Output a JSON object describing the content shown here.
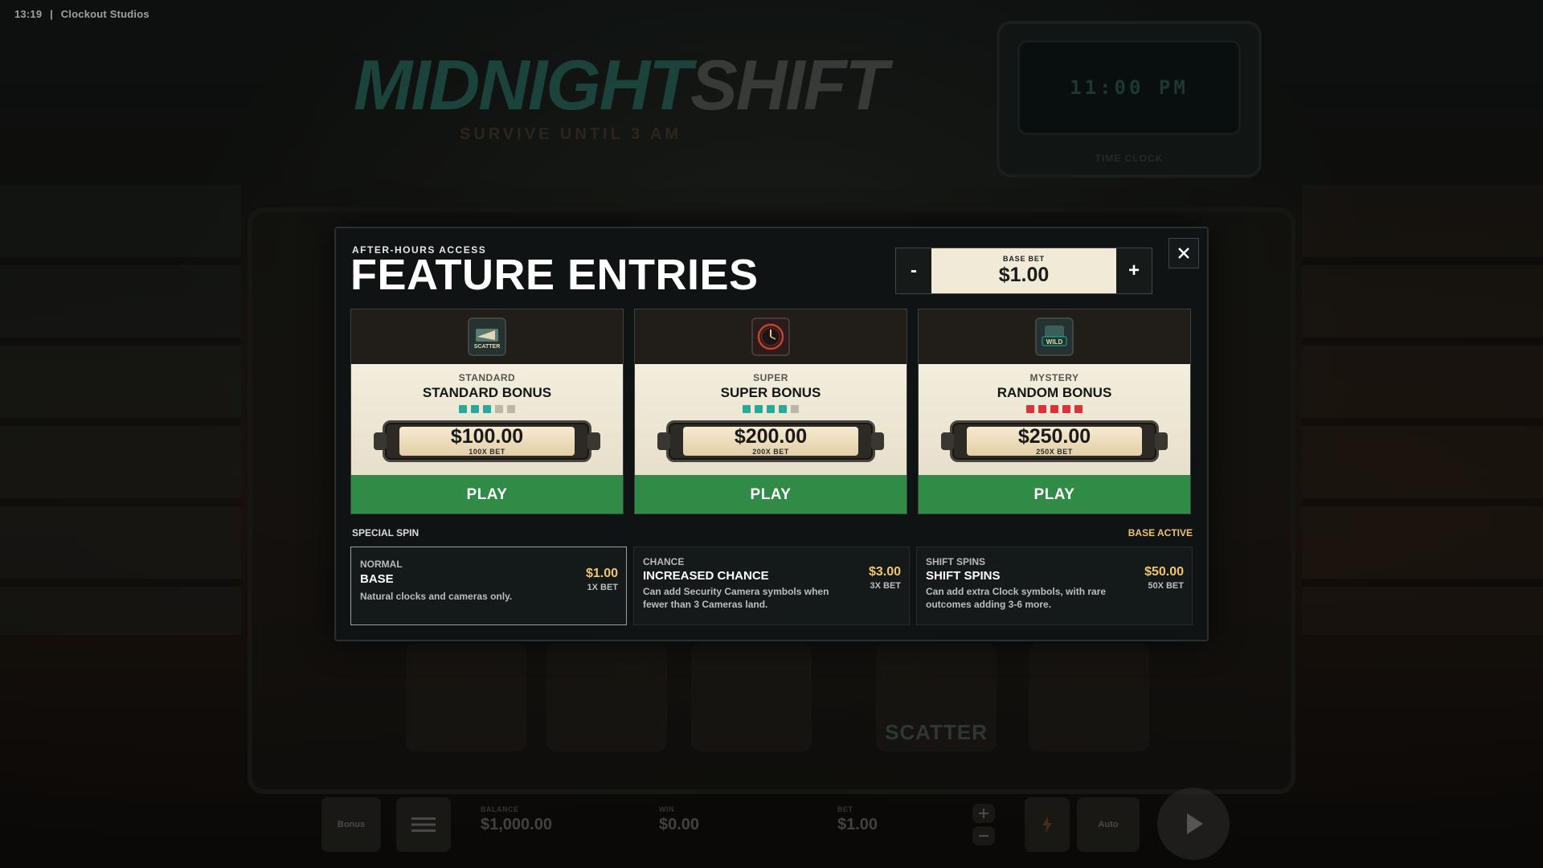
{
  "status_bar": {
    "time": "13:19",
    "separator": "|",
    "studio": "Clockout Studios"
  },
  "logo": {
    "word1": "MIDNIGHT",
    "word2": "SHIFT",
    "tagline": "SURVIVE UNTIL 3 AM"
  },
  "time_clock": {
    "display": "11:00 PM",
    "label": "TIME CLOCK"
  },
  "reel_symbol_label": "SCATTER",
  "bottom_bar": {
    "bonus_label": "Bonus",
    "balance_label": "BALANCE",
    "balance_value": "$1,000.00",
    "win_label": "WIN",
    "win_value": "$0.00",
    "bet_label": "BET",
    "bet_value": "$1.00",
    "auto_label": "Auto"
  },
  "modal": {
    "eyebrow": "AFTER-HOURS ACCESS",
    "title": "FEATURE ENTRIES",
    "base_bet": {
      "label": "BASE BET",
      "value": "$1.00",
      "decrement": "-",
      "increment": "+"
    },
    "close_icon": "close-icon",
    "cards": [
      {
        "tier": "STANDARD",
        "name": "STANDARD BONUS",
        "icon": "scatter-icon",
        "icon_text": "SCATTER",
        "price": "$100.00",
        "multiplier": "100X BET",
        "pips_filled": 3,
        "pips_total": 5,
        "pip_color": "#2aa89a",
        "play_label": "PLAY"
      },
      {
        "tier": "SUPER",
        "name": "SUPER BONUS",
        "icon": "clock-icon",
        "icon_text": "",
        "price": "$200.00",
        "multiplier": "200X BET",
        "pips_filled": 4,
        "pips_total": 5,
        "pip_color": "#2aa89a",
        "play_label": "PLAY"
      },
      {
        "tier": "MYSTERY",
        "name": "RANDOM BONUS",
        "icon": "wild-icon",
        "icon_text": "WILD",
        "price": "$250.00",
        "multiplier": "250X BET",
        "pips_filled": 5,
        "pips_total": 5,
        "pip_color": "#d8343a",
        "play_label": "PLAY"
      }
    ],
    "special_spin_label": "SPECIAL SPIN",
    "special_spin_status": "BASE ACTIVE",
    "spin_options": [
      {
        "tag": "NORMAL",
        "name": "BASE",
        "desc": "Natural clocks and cameras only.",
        "price": "$1.00",
        "multiplier": "1X BET",
        "active": true
      },
      {
        "tag": "CHANCE",
        "name": "INCREASED CHANCE",
        "desc": "Can add Security Camera symbols when fewer than 3 Cameras land.",
        "price": "$3.00",
        "multiplier": "3X BET",
        "active": false
      },
      {
        "tag": "SHIFT SPINS",
        "name": "SHIFT SPINS",
        "desc": "Can add extra Clock symbols, with rare outcomes adding 3-6 more.",
        "price": "$50.00",
        "multiplier": "50X BET",
        "active": false
      }
    ]
  },
  "colors": {
    "play_green": "#2f8b46",
    "price_gold": "#f2c56a",
    "teal_pip": "#2aa89a",
    "red_pip": "#d8343a",
    "status_gold": "#f0c070"
  }
}
